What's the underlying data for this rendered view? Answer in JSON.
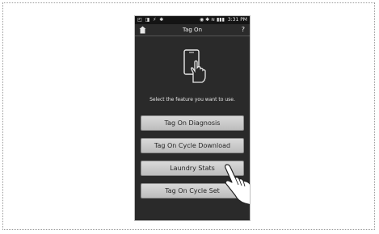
{
  "status_bar": {
    "left_icons": "◰ ◨ ⚡ ✱",
    "right_icons": "◉ ✱ ≋ ▮▮▮",
    "time": "3:31 PM"
  },
  "app_bar": {
    "title": "Tag On",
    "home_icon": "home-icon",
    "help_label": "?"
  },
  "main": {
    "hero_icon": "phone-tap-icon",
    "instruction": "Select the feature you want to use.",
    "buttons": [
      {
        "label": "Tag On Diagnosis"
      },
      {
        "label": "Tag On Cycle Download"
      },
      {
        "label": "Laundry Stats"
      },
      {
        "label": "Tag On Cycle Set"
      }
    ]
  },
  "overlay": {
    "pointer_icon": "pointing-hand-icon"
  },
  "colors": {
    "screen_bg": "#2a2a2a",
    "button_bg": "#cfcfcf",
    "button_text": "#262626",
    "text_light": "#e8e8e8"
  }
}
